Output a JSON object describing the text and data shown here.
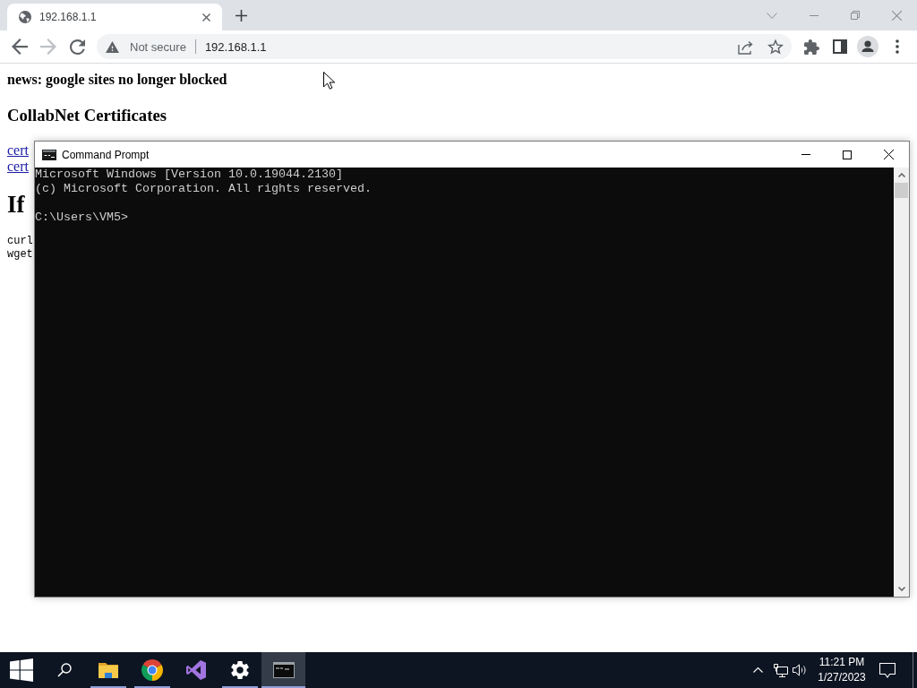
{
  "browser": {
    "tabs": [
      {
        "title": "192.168.1.1",
        "selected": true
      }
    ],
    "nav_buttons": [
      {
        "kind": "back",
        "disabled": false
      },
      {
        "kind": "forward",
        "disabled": true
      },
      {
        "kind": "reload",
        "disabled": false
      }
    ],
    "address_bar": {
      "security_label": "Not secure",
      "url": "192.168.1.1"
    }
  },
  "page": {
    "news": "news: google sites no longer blocked",
    "heading": "CollabNet Certificates",
    "links": [
      "cert",
      "cert"
    ],
    "heading_2": "If",
    "code_lines": [
      "curl",
      "wget"
    ]
  },
  "console_window": {
    "title": "Command Prompt",
    "output": [
      "Microsoft Windows [Version 10.0.19044.2130]",
      "(c) Microsoft Corporation. All rights reserved."
    ],
    "prompt": "C:\\Users\\VM5>"
  },
  "taskbar": {
    "apps": [
      {
        "kind": "folder",
        "running": true,
        "selected": false
      },
      {
        "kind": "browser",
        "running": true,
        "selected": false
      },
      {
        "kind": "ide",
        "running": false,
        "selected": false
      },
      {
        "kind": "settings",
        "running": true,
        "selected": false
      },
      {
        "kind": "terminal",
        "running": true,
        "selected": true
      }
    ],
    "clock": {
      "time": "11:21 PM",
      "date": "1/27/2023"
    }
  }
}
